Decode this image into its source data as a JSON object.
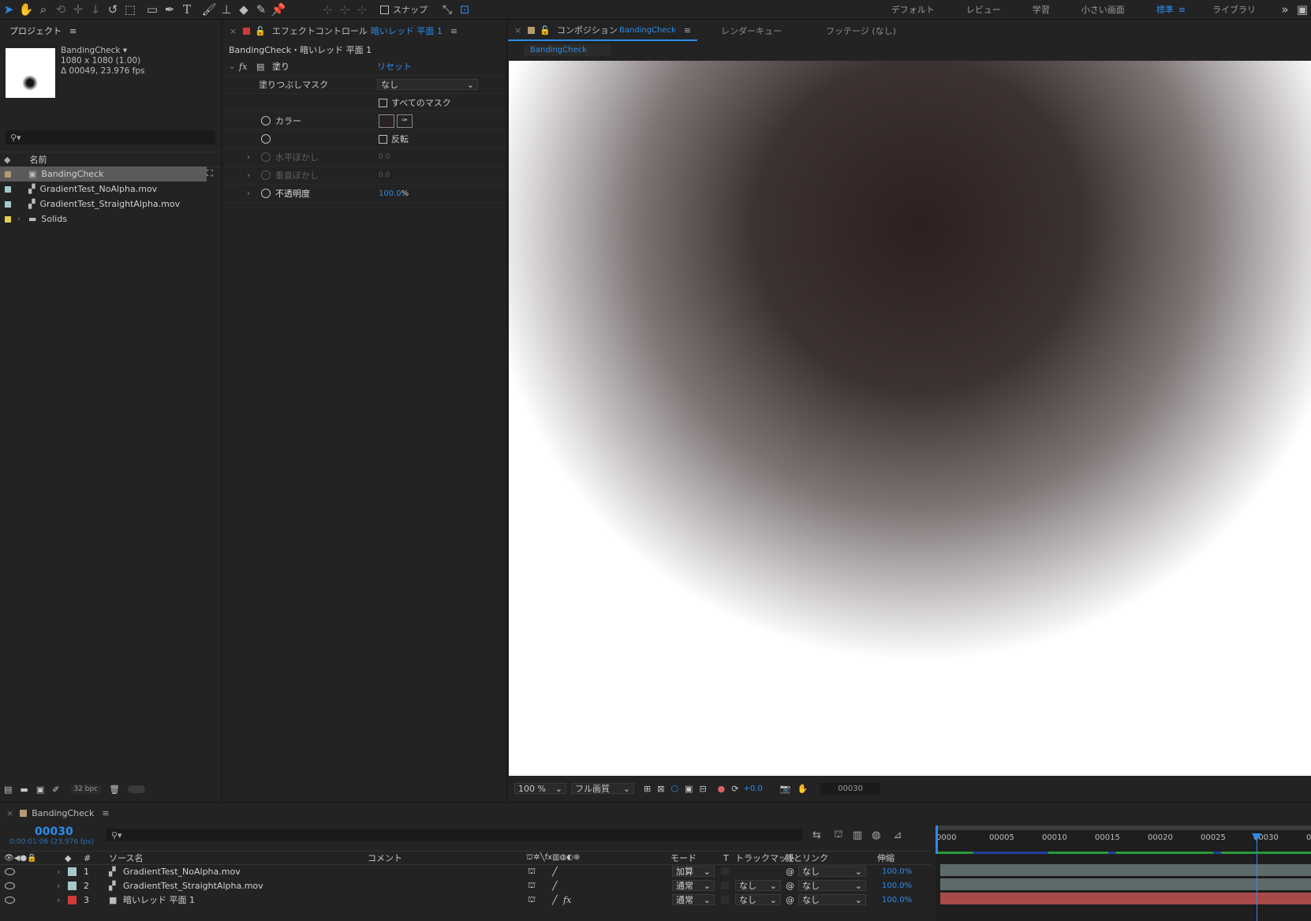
{
  "toolbar": {
    "snap_label": "スナップ",
    "workspaces": [
      "デフォルト",
      "レビュー",
      "学習",
      "小さい画面",
      "標準",
      "ライブラリ"
    ],
    "active_workspace": "標準"
  },
  "project": {
    "title": "プロジェクト",
    "selected_name": "BandingCheck ▾",
    "selected_size": "1080 x 1080 (1.00)",
    "selected_duration": "Δ 00049, 23.976 fps",
    "column_name": "名前",
    "items": [
      {
        "name": "BandingCheck",
        "color": "#b59a74",
        "type": "comp",
        "selected": true
      },
      {
        "name": "GradientTest_NoAlpha.mov",
        "color": "#a6c9c9",
        "type": "footage",
        "selected": false
      },
      {
        "name": "GradientTest_StraightAlpha.mov",
        "color": "#a6c9c9",
        "type": "footage",
        "selected": false
      },
      {
        "name": "Solids",
        "color": "#e6d050",
        "type": "folder",
        "selected": false
      }
    ],
    "bpc": "32 bpc"
  },
  "effect_controls": {
    "tab_prefix": "エフェクトコントロール",
    "tab_layer": "暗いレッド 平面 1",
    "breadcrumb": "BandingCheck・暗いレッド 平面 1",
    "effect_name": "塗り",
    "reset_label": "リセット",
    "fill_mask_label": "塗りつぶしマスク",
    "fill_mask_value": "なし",
    "all_masks_label": "すべてのマスク",
    "color_label": "カラー",
    "invert_label": "反転",
    "h_feather_label": "水平ぼかし",
    "h_feather_value": "0.0",
    "v_feather_label": "垂直ぼかし",
    "v_feather_value": "0.0",
    "opacity_label": "不透明度",
    "opacity_value": "100.0",
    "opacity_unit": "%",
    "fill_color": "#2a2222"
  },
  "composition": {
    "tab_prefix": "コンポジション",
    "tab_name": "BandingCheck",
    "render_queue": "レンダーキュー",
    "footage_tab": "フッテージ (なし)",
    "sub_tab": "BandingCheck",
    "zoom": "100 %",
    "quality": "フル画質",
    "exposure": "+0.0",
    "timecode": "00030"
  },
  "timeline": {
    "tab_name": "BandingCheck",
    "current_time": "00030",
    "current_time_sub": "0:00:01:06 (23.976 fps)",
    "col_source": "ソース名",
    "col_comment": "コメント",
    "col_mode": "モード",
    "col_t": "T",
    "col_trackmatte": "トラックマット",
    "col_parent": "親とリンク",
    "col_stretch": "伸縮",
    "ruler_labels": [
      "0000",
      "00005",
      "00010",
      "00015",
      "00020",
      "00025",
      "00030",
      "000"
    ],
    "layers": [
      {
        "num": "1",
        "name": "GradientTest_NoAlpha.mov",
        "color": "#a6c9c9",
        "mode": "加算",
        "matte": "",
        "parent": "なし",
        "stretch": "100.0%",
        "fx": "",
        "bar": "#5d6a6a"
      },
      {
        "num": "2",
        "name": "GradientTest_StraightAlpha.mov",
        "color": "#a6c9c9",
        "mode": "通常",
        "matte": "なし",
        "parent": "なし",
        "stretch": "100.0%",
        "fx": "",
        "bar": "#5d6a6a"
      },
      {
        "num": "3",
        "name": "暗いレッド 平面 1",
        "color": "#d03a3a",
        "mode": "通常",
        "matte": "なし",
        "parent": "なし",
        "stretch": "100.0%",
        "fx": "fx",
        "bar": "#a84a4a"
      }
    ]
  }
}
